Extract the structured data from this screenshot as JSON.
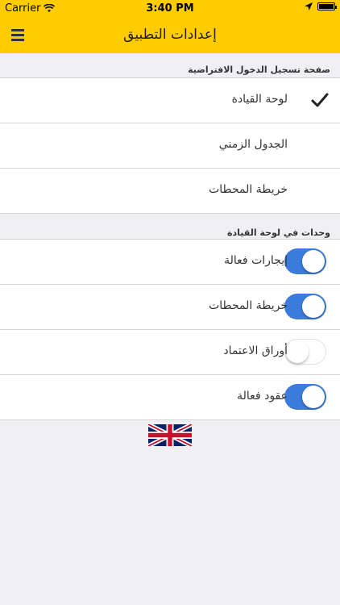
{
  "status_bar": {
    "carrier": "Carrier",
    "time": "3:40 PM"
  },
  "nav": {
    "title": "إعدادات التطبيق",
    "menu_icon": "hamburger-menu-icon"
  },
  "default_page": {
    "header": "صفحة تسجيل الدخول الافتراضية",
    "options": [
      {
        "label": "لوحة القيادة",
        "selected": true
      },
      {
        "label": "الجدول الزمني",
        "selected": false
      },
      {
        "label": "خريطة المحطات",
        "selected": false
      }
    ]
  },
  "dashboard_units": {
    "header": "وحدات في لوحة القيادة",
    "items": [
      {
        "label": "إيجارات فعالة",
        "enabled": true
      },
      {
        "label": "خريطة المحطات",
        "enabled": true
      },
      {
        "label": "أوراق الاعتماد",
        "enabled": false
      },
      {
        "label": "عقود فعالة",
        "enabled": true
      }
    ]
  },
  "language": {
    "icon": "uk-flag-icon"
  },
  "colors": {
    "header_bg": "#ffcc00",
    "toggle_on": "#3a7bdc",
    "background": "#efeff4"
  }
}
